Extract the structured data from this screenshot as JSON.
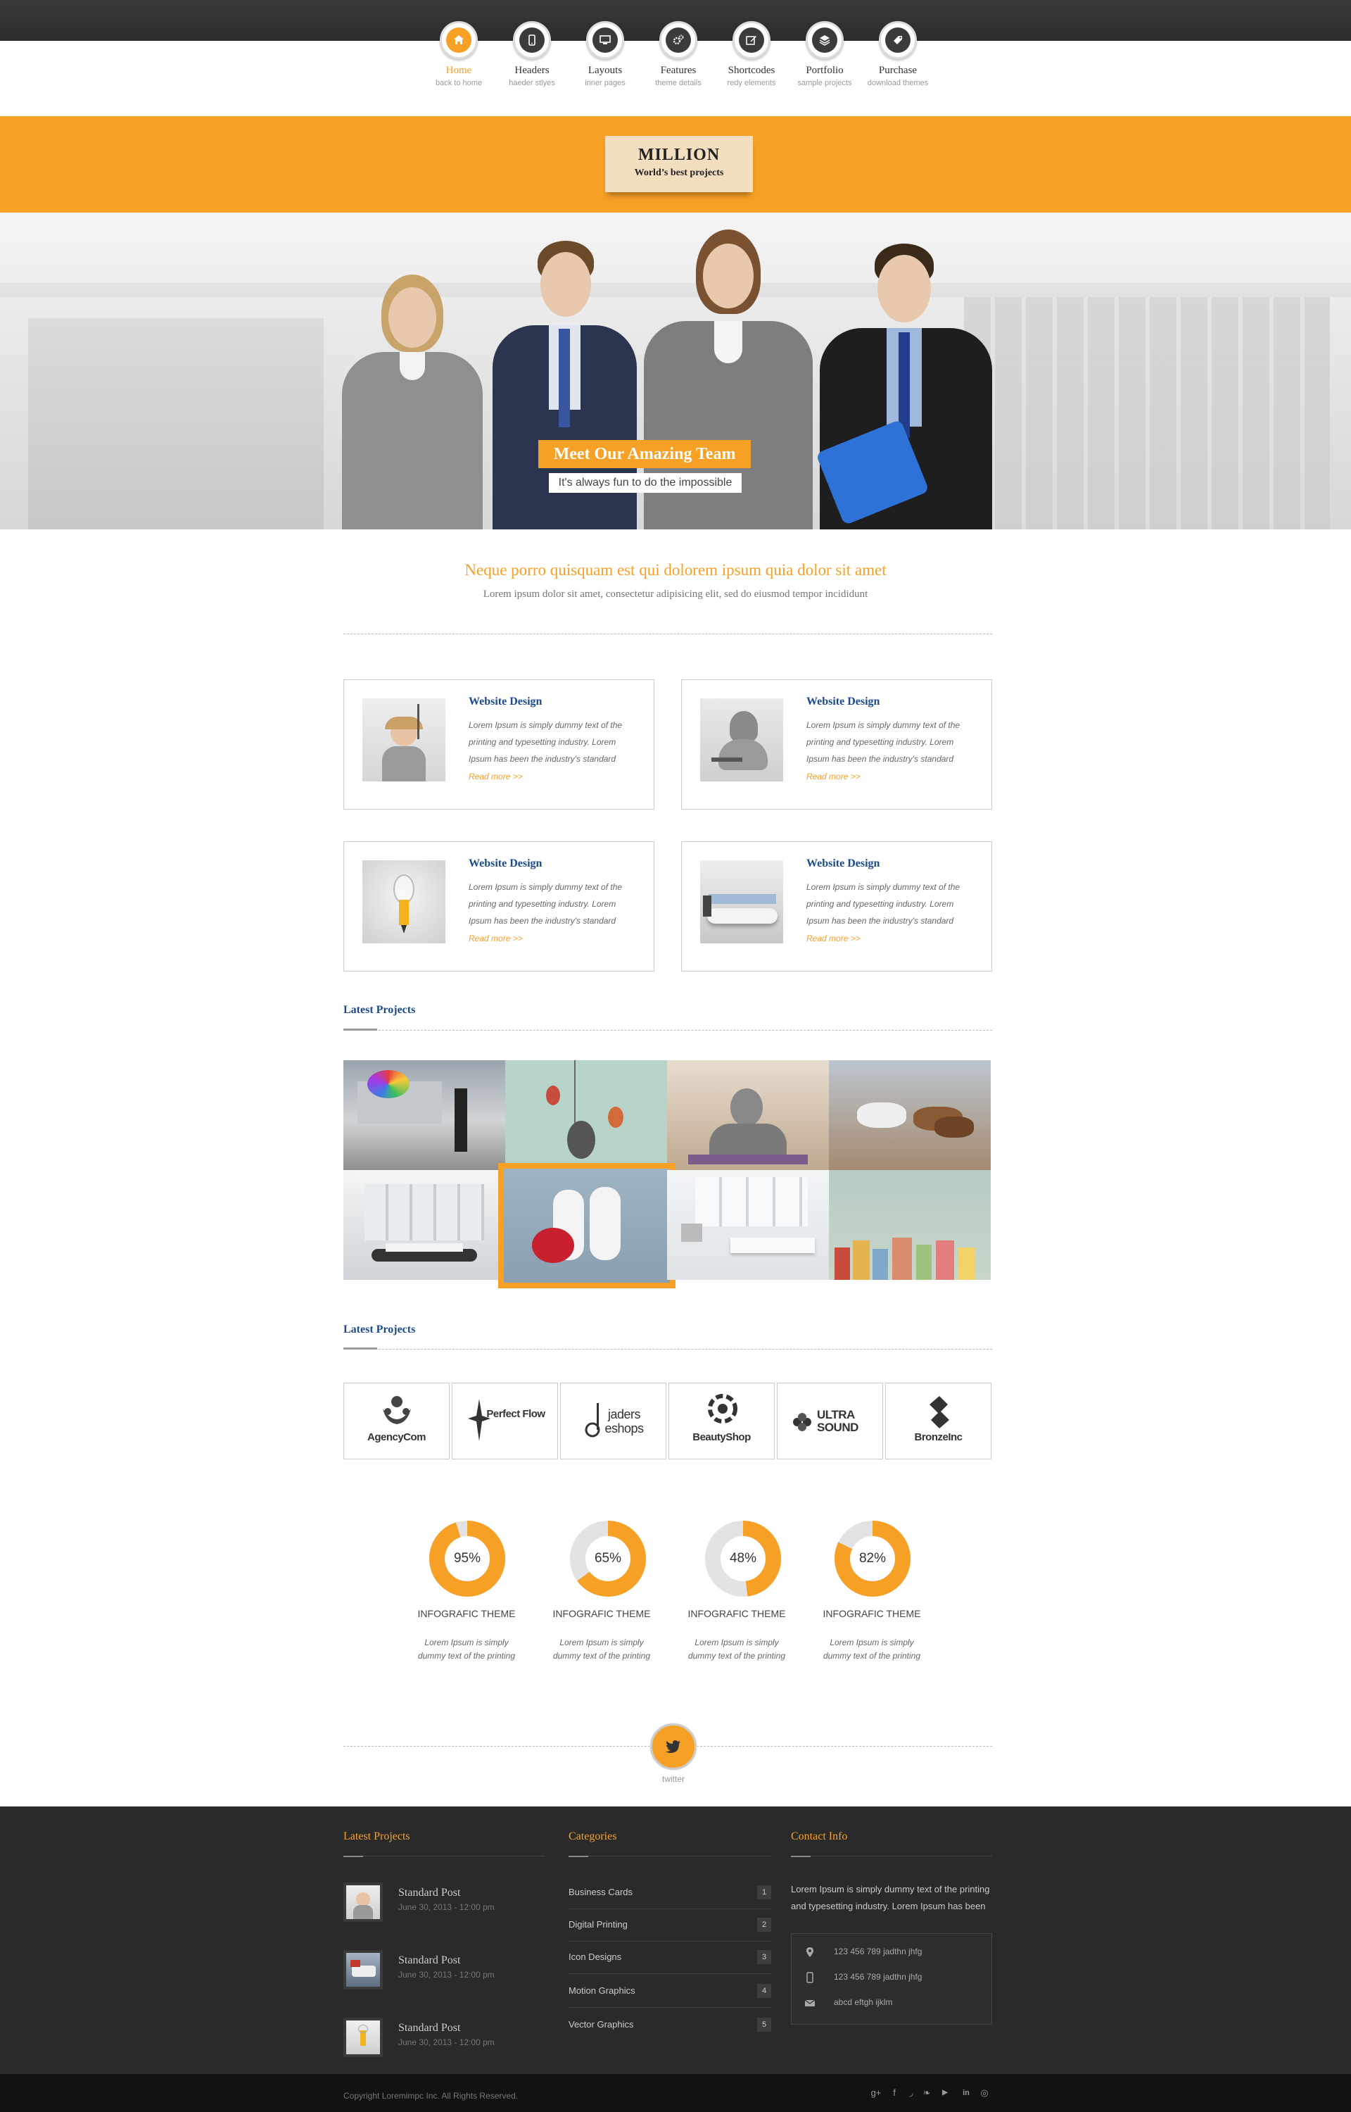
{
  "nav": {
    "items": [
      {
        "label": "Home",
        "sub": "back to home",
        "icon": "home-icon"
      },
      {
        "label": "Headers",
        "sub": "haeder stlyes",
        "icon": "phone-icon"
      },
      {
        "label": "Layouts",
        "sub": "inner pages",
        "icon": "monitor-icon"
      },
      {
        "label": "Features",
        "sub": "theme details",
        "icon": "gears-icon"
      },
      {
        "label": "Shortcodes",
        "sub": "redy elements",
        "icon": "edit-icon"
      },
      {
        "label": "Portfolio",
        "sub": "sample projects",
        "icon": "layers-icon"
      },
      {
        "label": "Purchase",
        "sub": "download themes",
        "icon": "tag-icon"
      }
    ]
  },
  "logo": {
    "title": "MILLION",
    "tagline": "World’s best projects"
  },
  "hero": {
    "title": "Meet Our Amazing Team",
    "subtitle": "It's always fun to do the impossible"
  },
  "intro": {
    "heading": "Neque porro quisquam est qui dolorem ipsum quia dolor sit amet",
    "text": "Lorem ipsum dolor sit amet, consectetur adipisicing elit, sed do eiusmod tempor incididunt"
  },
  "services": [
    {
      "title": "Website Design",
      "text": "Lorem Ipsum is simply dummy text of the printing and typesetting industry. Lorem Ipsum has been the industry's standard",
      "link": "Read more >>"
    },
    {
      "title": "Website Design",
      "text": "Lorem Ipsum is simply dummy text of the printing and typesetting industry. Lorem Ipsum has been the industry's standard",
      "link": "Read more >>"
    },
    {
      "title": "Website Design",
      "text": "Lorem Ipsum is simply dummy text of the printing and typesetting industry. Lorem Ipsum has been the industry's standard",
      "link": "Read more >>"
    },
    {
      "title": "Website Design",
      "text": "Lorem Ipsum is simply dummy text of the printing and typesetting industry. Lorem Ipsum has been the industry's standard",
      "link": "Read more >>"
    }
  ],
  "projects": {
    "heading": "Latest Projects"
  },
  "clients": {
    "heading": "Latest Projects",
    "logos": [
      "AgencyCom",
      "Perfect Flow",
      "jaders eshops",
      "BeautyShop",
      "ULTRA SOUND",
      "BronzeInc"
    ]
  },
  "stats": [
    {
      "value": 95,
      "label": "INFOGRAFIC THEME",
      "text": "Lorem Ipsum is simply dummy text of the printing"
    },
    {
      "value": 65,
      "label": "INFOGRAFIC THEME",
      "text": "Lorem Ipsum is simply dummy text of the printing"
    },
    {
      "value": 48,
      "label": "INFOGRAFIC THEME",
      "text": "Lorem Ipsum is simply dummy text of the printing"
    },
    {
      "value": 82,
      "label": "INFOGRAFIC THEME",
      "text": "Lorem Ipsum is simply dummy text of the printing"
    }
  ],
  "twitter": {
    "label": "twitter"
  },
  "footer": {
    "latest": {
      "heading": "Latest Projects",
      "posts": [
        {
          "title": "Standard Post",
          "date": "June 30, 2013 - 12:00 pm"
        },
        {
          "title": "Standard Post",
          "date": "June 30, 2013 - 12:00 pm"
        },
        {
          "title": "Standard Post",
          "date": "June 30, 2013 - 12:00 pm"
        }
      ]
    },
    "categories": {
      "heading": "Categories",
      "items": [
        {
          "name": "Business Cards",
          "count": "1"
        },
        {
          "name": "Digital Printing",
          "count": "2"
        },
        {
          "name": "Icon Designs",
          "count": "3"
        },
        {
          "name": "Motion Graphics",
          "count": "4"
        },
        {
          "name": "Vector Graphics",
          "count": "5"
        }
      ]
    },
    "contact": {
      "heading": "Contact Info",
      "text": "Lorem Ipsum is simply dummy text of the printing and typesetting industry. Lorem Ipsum has been",
      "phone": "123 456 789 jadthn  jhfg",
      "mobile": "123 456 789 jadthn  jhfg",
      "email": "abcd eftgh ijklm"
    }
  },
  "bottom": {
    "copyright": "Copyright  Loremimpc Inc. All Rights Reserved.",
    "social": [
      "google-plus-icon",
      "facebook-icon",
      "rss-icon",
      "twitter-icon",
      "youtube-icon",
      "linkedin-icon",
      "dribbble-icon"
    ]
  },
  "colors": {
    "accent": "#f7a026",
    "heading_blue": "#1c4a8a",
    "footer_bg": "#2a2a2a",
    "topbar": "#333333"
  }
}
